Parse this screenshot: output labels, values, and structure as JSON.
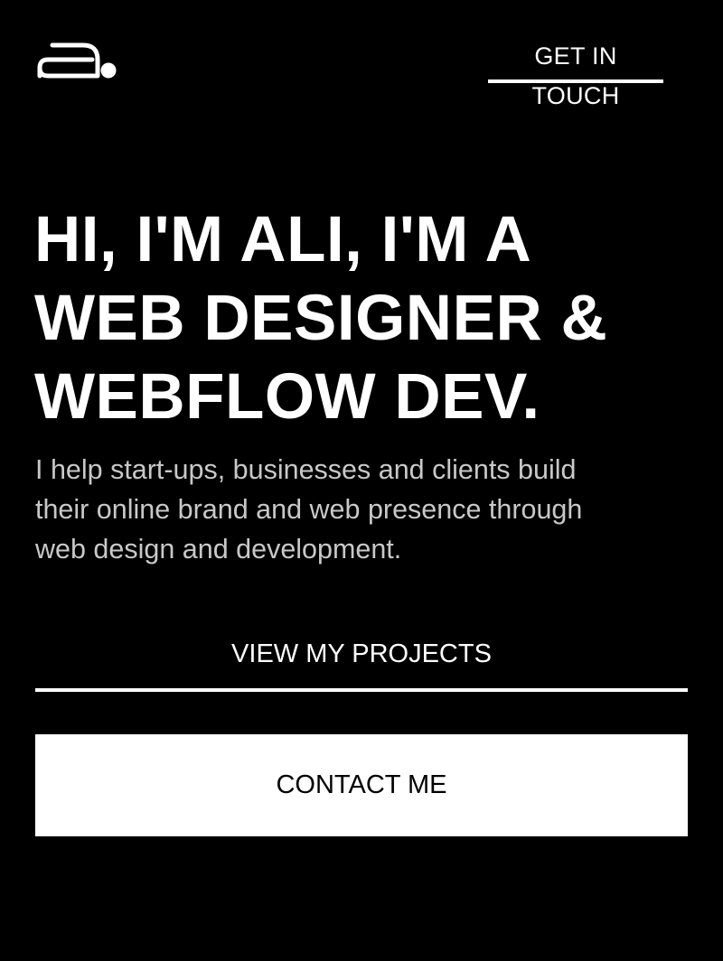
{
  "header": {
    "logo_icon": "stylized-a-logo-icon",
    "nav_link_label": "GET IN TOUCH"
  },
  "hero": {
    "headline_lines": [
      "HI, I'M ALI, I'M A",
      "WEB DESIGNER &",
      "WEBFLOW DEV."
    ],
    "intro_lines": [
      "I help start-ups, businesses and clients build",
      "their online brand and web presence through",
      "web design and development."
    ]
  },
  "actions": {
    "view_projects_label": "VIEW MY PROJECTS",
    "contact_label": "CONTACT ME"
  },
  "colors": {
    "background": "#000000",
    "primary_text": "#ffffff",
    "secondary_text": "#c8c8c8",
    "button_fill": "#ffffff",
    "button_text": "#000000"
  }
}
